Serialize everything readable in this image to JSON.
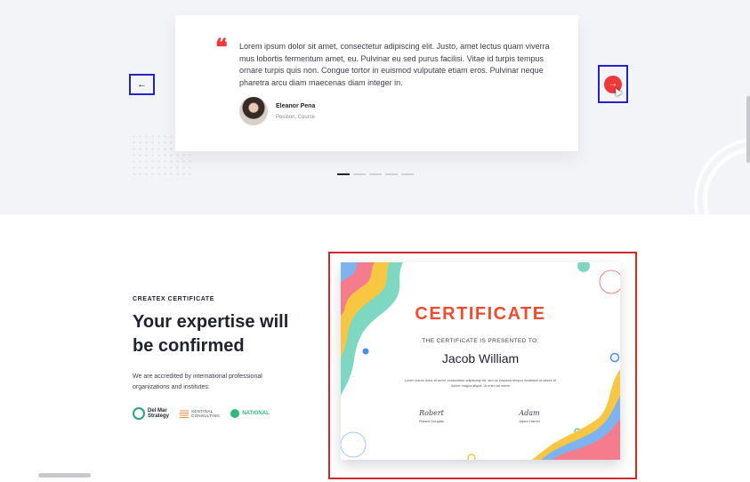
{
  "testimonial": {
    "quote": "Lorem ipsum dolor sit amet, consectetur adipiscing elit. Justo, amet lectus quam viverra mus lobortis fermentum amet, eu. Pulvinar eu sed purus facilisi. Vitae id turpis tempus ornare turpis quis non. Congue tortor in euismod vulputate etiam eros. Pulvinar neque pharetra arcu diam maecenas diam integer in.",
    "author_name": "Eleanor Pena",
    "author_role": "Position, Course",
    "prev_icon": "←",
    "next_icon": "→",
    "pager_count": 5,
    "pager_active": 1
  },
  "certificate_section": {
    "eyebrow": "CREATEX CERTIFICATE",
    "headline": "Your expertise will be confirmed",
    "description": "We are accredited by international professional organizations and institutes:",
    "logos": [
      {
        "icon": "del-mar-logo",
        "line1": "Del Mar",
        "line2": "Strategy"
      },
      {
        "icon": "sentinal-logo",
        "line1": "SENTINAL",
        "line2": "CONSULTING"
      },
      {
        "icon": "national-logo",
        "line1": "NATIONAL",
        "line2": ""
      }
    ]
  },
  "certificate": {
    "title": "CERTIFICATE",
    "presented": "THE CERTIFICATE IS PRESENTED TO:",
    "recipient": "Jacob William",
    "body": "Lorem ipsum dolor sit amet, consectetur adipiscing elit, sed do eiusmod tempor incididunt ut labore et dolore magna aliqua. Ut enim ad minim",
    "signatures": [
      {
        "script": "Robert",
        "name": "Robert Douglas"
      },
      {
        "script": "Adam",
        "name": "Adam Harold"
      }
    ]
  },
  "colors": {
    "accent": "#ec3a3a",
    "highlight_box": "#2323c8",
    "cert_border": "#d22a2a",
    "cert_title": "#ef4b2e"
  }
}
